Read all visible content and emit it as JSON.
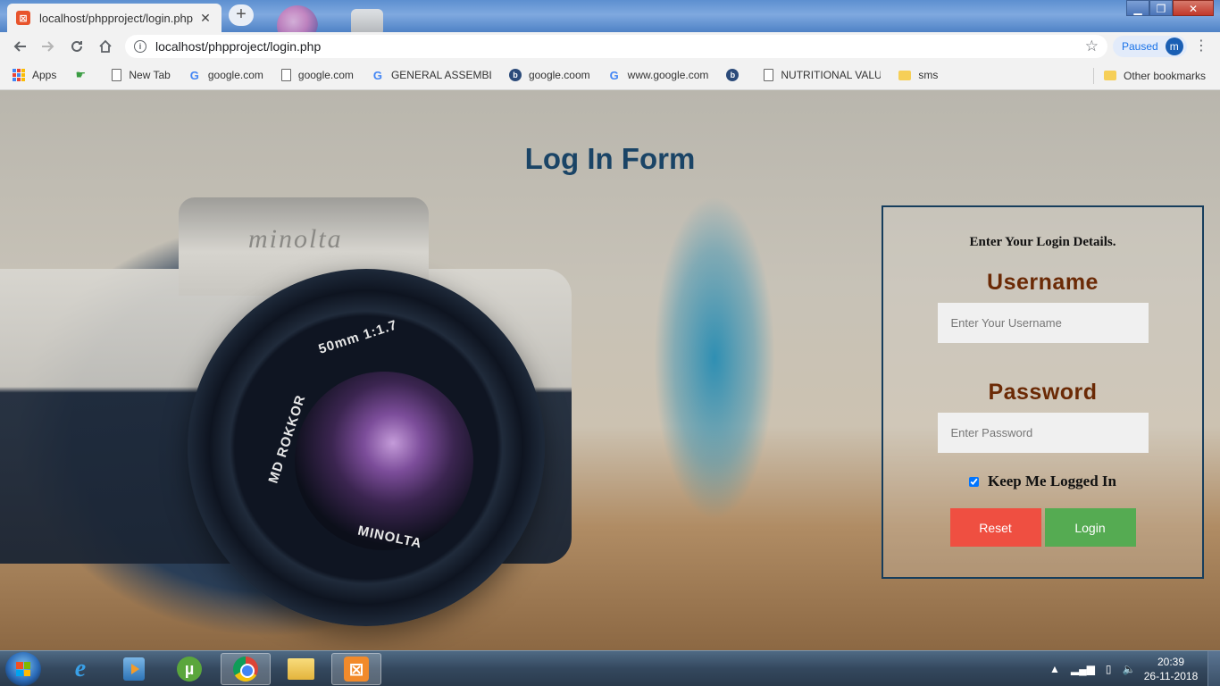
{
  "browser": {
    "tab": {
      "title": "localhost/phpproject/login.php",
      "favicon": "xampp-icon",
      "close": "✕"
    },
    "new_tab": "+",
    "address": "localhost/phpproject/login.php",
    "profile": {
      "status": "Paused",
      "initial": "m"
    },
    "window_controls": {
      "minimize": "▁",
      "maximize": "❐",
      "close": "✕"
    }
  },
  "bookmarks": {
    "items": [
      {
        "label": "Apps",
        "icon": "apps-grid-icon"
      },
      {
        "label": "",
        "icon": "hand-icon"
      },
      {
        "label": "New Tab",
        "icon": "page-icon"
      },
      {
        "label": "google.com",
        "icon": "google-icon"
      },
      {
        "label": "google.com",
        "icon": "page-icon"
      },
      {
        "label": "GENERAL ASSEMBLY",
        "icon": "google-icon"
      },
      {
        "label": "google.coom",
        "icon": "round-b-icon"
      },
      {
        "label": "www.google.com",
        "icon": "google-icon"
      },
      {
        "label": "",
        "icon": "round-b-icon"
      },
      {
        "label": "NUTRITIONAL VALUE",
        "icon": "page-icon"
      },
      {
        "label": "sms",
        "icon": "folder-icon"
      }
    ],
    "other": "Other bookmarks"
  },
  "page": {
    "title": "Log In Form",
    "background": "camera-photo",
    "camera_brand": "minolta",
    "lens_text": [
      "50mm 1:1.7",
      "MD ROKKOR",
      "MINOLTA"
    ],
    "form": {
      "subtitle": "Enter Your Login Details.",
      "username_label": "Username",
      "username_placeholder": "Enter Your Username",
      "password_label": "Password",
      "password_placeholder": "Enter Password",
      "remember_label": "Keep Me Logged In",
      "remember_checked": true,
      "reset_label": "Reset",
      "login_label": "Login"
    },
    "colors": {
      "title": "#1a4466",
      "field_label": "#6b2a06",
      "box_border": "#163d5c",
      "reset": "#ef4f41",
      "login": "#55ab52"
    }
  },
  "taskbar": {
    "apps": [
      "start-orb",
      "internet-explorer-icon",
      "media-player-icon",
      "utorrent-icon",
      "chrome-icon",
      "file-explorer-icon",
      "xampp-icon"
    ],
    "clock": {
      "time": "20:39",
      "date": "26-11-2018"
    }
  }
}
